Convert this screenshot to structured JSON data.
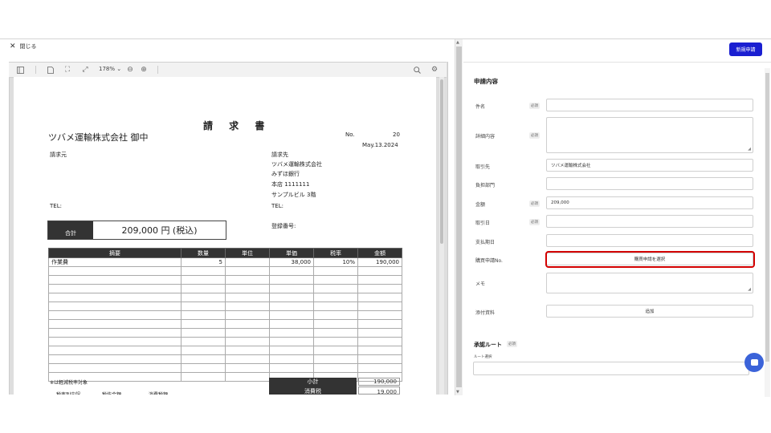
{
  "top": {
    "close_label": "閉じる",
    "new_button": "新規申請"
  },
  "viewer": {
    "zoom": "178%"
  },
  "invoice": {
    "title": "請 求 書",
    "client": "ツバメ運輸株式会社 御中",
    "no_label": "No.",
    "no_value": "20",
    "date": "May.13.2024",
    "from_label": "請求元",
    "tel_left": "TEL:",
    "to_label": "請求先",
    "to_company": "ツバメ運輸株式会社",
    "to_bank": "みずほ銀行",
    "to_branch": "本店 1111111",
    "to_building": "サンプルビル 3階",
    "tel_right": "TEL:",
    "reg_label": "登録番号:",
    "total_label": "合計",
    "total_value": "209,000 円 (税込)",
    "columns": [
      "摘要",
      "数量",
      "単位",
      "単価",
      "税率",
      "金額"
    ],
    "rows": [
      [
        "作業費",
        "5",
        "",
        "38,000",
        "10%",
        "190,000"
      ]
    ],
    "empty_rows": 13,
    "note": "※は軽減税率対象",
    "subtotal_label": "小計",
    "subtotal_value": "190,000",
    "tax_label": "消費税",
    "tax_value": "19,000",
    "footer_cols": [
      "税率別内訳",
      "税抜金額",
      "消費税額"
    ]
  },
  "form": {
    "section_title": "申請内容",
    "required_badge": "必須",
    "fields": {
      "subject": {
        "label": "件名",
        "value": ""
      },
      "detail": {
        "label": "詳細内容",
        "value": ""
      },
      "partner": {
        "label": "取引先",
        "value": "ツバメ運輸株式会社"
      },
      "dept": {
        "label": "負担部門",
        "value": ""
      },
      "amount": {
        "label": "金額",
        "value": "209,000"
      },
      "trade_date": {
        "label": "取引日",
        "value": ""
      },
      "pay_date": {
        "label": "支払期日",
        "value": ""
      },
      "purchase_no": {
        "label": "購買申請No.",
        "button": "購買申請を選択"
      },
      "memo": {
        "label": "メモ",
        "value": ""
      },
      "attachment": {
        "label": "添付資料",
        "button": "追加"
      }
    },
    "route_title": "承認ルート",
    "route_sub": "ルート選択"
  }
}
